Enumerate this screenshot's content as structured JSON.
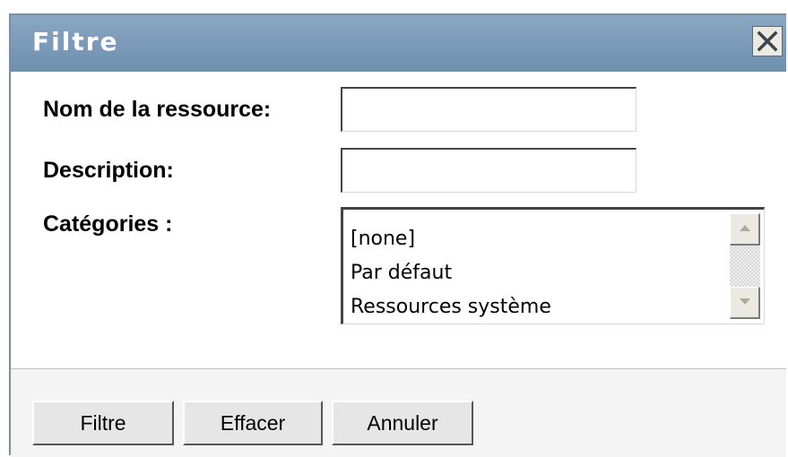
{
  "dialog": {
    "title": "Filtre",
    "close_icon": "close-icon"
  },
  "form": {
    "resource_name_label": "Nom de la ressource:",
    "resource_name_value": "",
    "description_label": "Description:",
    "description_value": "",
    "categories_label": "Catégories :",
    "categories": [
      "[none]",
      "Par défaut",
      "Ressources système"
    ]
  },
  "buttons": {
    "filter_label": "Filtre",
    "clear_label": "Effacer",
    "cancel_label": "Annuler"
  },
  "colors": {
    "titlebar_top": "#8aa7c2",
    "titlebar_bottom": "#6f8fb0",
    "title_text": "#ffffff"
  }
}
